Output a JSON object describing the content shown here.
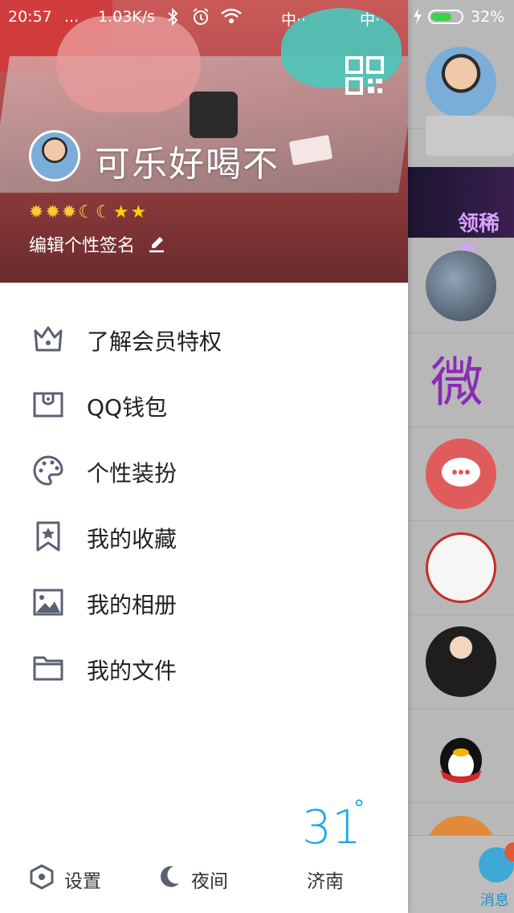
{
  "status_bar": {
    "time": "20:57",
    "dots": "...",
    "net_speed": "1.03K/s",
    "carrier1": "中·· ",
    "carrier2": "中·",
    "battery_pct": "32%",
    "battery_level": 0.32,
    "battery_color": "#3ad24a"
  },
  "profile": {
    "nickname": "可乐好喝不",
    "level_icons": [
      "sun",
      "sun",
      "sun",
      "moon",
      "moon",
      "star",
      "star"
    ],
    "signature_prompt": "编辑个性签名"
  },
  "menu": {
    "items": [
      {
        "label": "了解会员特权",
        "icon": "crown-icon"
      },
      {
        "label": "QQ钱包",
        "icon": "wallet-icon"
      },
      {
        "label": "个性装扮",
        "icon": "palette-icon"
      },
      {
        "label": "我的收藏",
        "icon": "bookmark-star-icon"
      },
      {
        "label": "我的相册",
        "icon": "photo-icon"
      },
      {
        "label": "我的文件",
        "icon": "folder-icon"
      }
    ]
  },
  "footer": {
    "settings_label": "设置",
    "night_label": "夜间"
  },
  "weather": {
    "temperature": "31",
    "degree_symbol": "°",
    "city": "济南",
    "accent_color": "#22a7e6"
  },
  "chat_list": {
    "banner_text": "领稀有",
    "tab_label": "消息"
  },
  "colors": {
    "icon_gray": "#5b6072",
    "text_dark": "#222222"
  }
}
